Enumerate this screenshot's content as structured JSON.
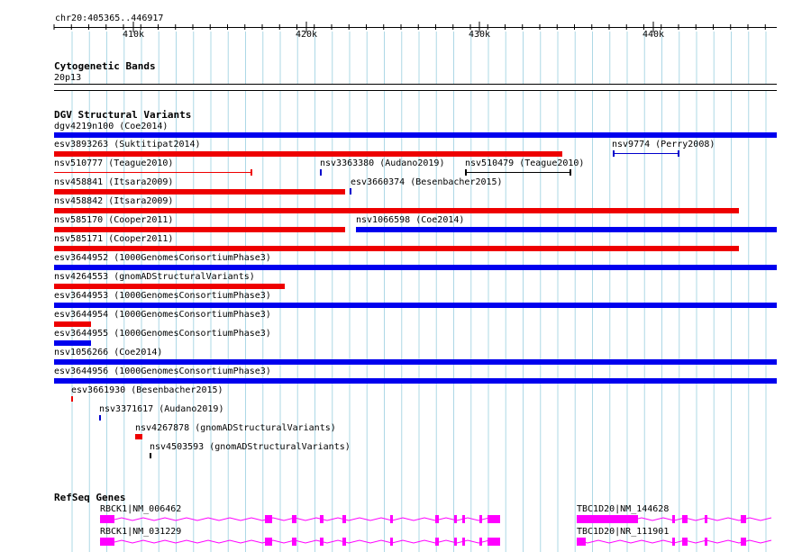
{
  "ruler": {
    "location": "chr20:405365..446917",
    "ticks": [
      "410k",
      "420k",
      "430k",
      "440k"
    ]
  },
  "tracks": {
    "cytoband": {
      "title": "Cytogenetic Bands",
      "band": "20p13"
    },
    "dgv": {
      "title": "DGV Structural Variants",
      "features": [
        {
          "label": "dgv4219n100 (Coe2014)",
          "color": "#0000ee"
        },
        {
          "label": "esv3893263 (Suktitipat2014)",
          "color": "#ee0000"
        },
        {
          "label": "nsv9774 (Perry2008)",
          "color": "#0000cc"
        },
        {
          "label": "nsv510777 (Teague2010)",
          "color": "#ee0000"
        },
        {
          "label": "nsv3363380 (Audano2019)",
          "color": "#0000cc"
        },
        {
          "label": "nsv510479 (Teague2010)",
          "color": "#000000"
        },
        {
          "label": "nsv458841 (Itsara2009)",
          "color": "#ee0000"
        },
        {
          "label": "esv3660374 (Besenbacher2015)",
          "color": "#0000cc"
        },
        {
          "label": "nsv458842 (Itsara2009)",
          "color": "#ee0000"
        },
        {
          "label": "nsv585170 (Cooper2011)",
          "color": "#ee0000"
        },
        {
          "label": "nsv1066598 (Coe2014)",
          "color": "#0000ee"
        },
        {
          "label": "nsv585171 (Cooper2011)",
          "color": "#ee0000"
        },
        {
          "label": "esv3644952 (1000GenomesConsortiumPhase3)",
          "color": "#0000ee"
        },
        {
          "label": "nsv4264553 (gnomADStructuralVariants)",
          "color": "#ee0000"
        },
        {
          "label": "esv3644953 (1000GenomesConsortiumPhase3)",
          "color": "#0000ee"
        },
        {
          "label": "esv3644954 (1000GenomesConsortiumPhase3)",
          "color": "#ee0000"
        },
        {
          "label": "esv3644955 (1000GenomesConsortiumPhase3)",
          "color": "#0000ee"
        },
        {
          "label": "nsv1056266 (Coe2014)",
          "color": "#0000ee"
        },
        {
          "label": "esv3644956 (1000GenomesConsortiumPhase3)",
          "color": "#0000ee"
        },
        {
          "label": "esv3661930 (Besenbacher2015)",
          "color": "#ee0000"
        },
        {
          "label": "nsv3371617 (Audano2019)",
          "color": "#0000cc"
        },
        {
          "label": "nsv4267878 (gnomADStructuralVariants)",
          "color": "#ee0000"
        },
        {
          "label": "nsv4503593 (gnomADStructuralVariants)",
          "color": "#000000"
        }
      ]
    },
    "refseq": {
      "title": "RefSeq Genes",
      "color": "#ff00ff",
      "genes": [
        {
          "label": "RBCK1|NM_006462"
        },
        {
          "label": "TBC1D20|NM_144628"
        },
        {
          "label": "RBCK1|NM_031229"
        },
        {
          "label": "TBC1D20|NR_111901"
        }
      ]
    }
  },
  "colors": {
    "grid": "#add8e6",
    "blue": "#0000ee",
    "red": "#ee0000",
    "magenta": "#ff00ff"
  }
}
